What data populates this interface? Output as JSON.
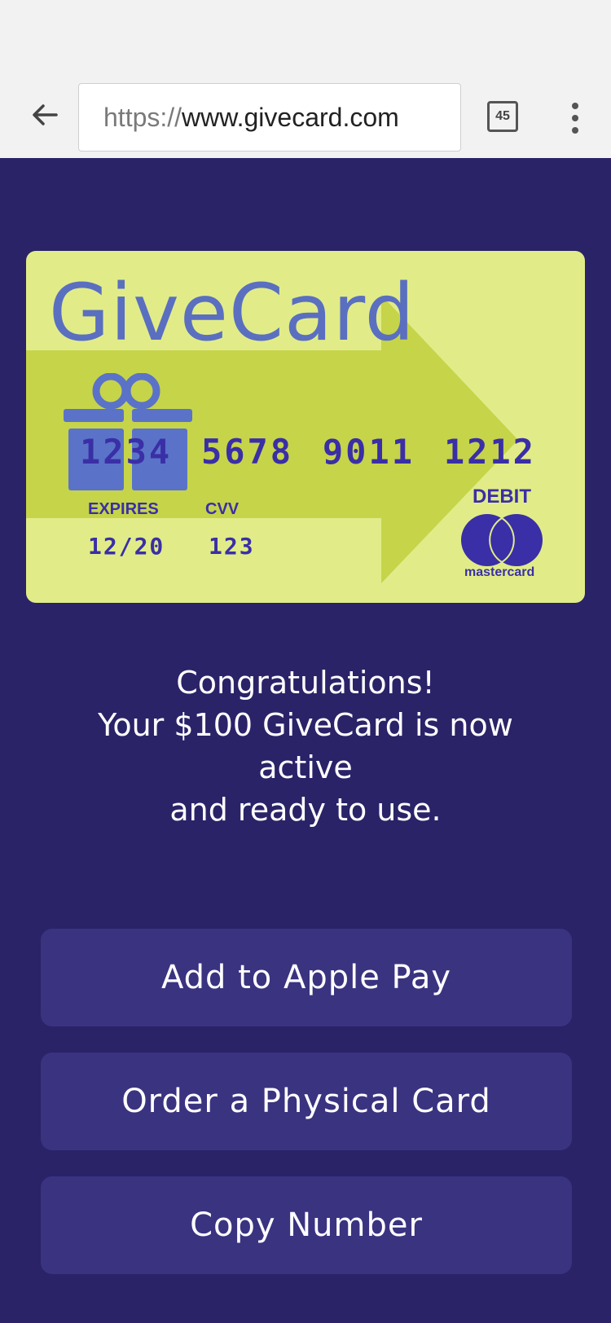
{
  "browser": {
    "url_scheme": "https://",
    "url_host": "www.givecard.com",
    "tab_count": "45",
    "icons": {
      "back": "back-arrow-icon",
      "tabs": "tabs-icon",
      "menu": "more-vert-icon"
    }
  },
  "card": {
    "brand": "GiveCard",
    "number_groups": [
      "1234",
      "5678",
      "9011",
      "1212"
    ],
    "expires_label": "EXPIRES",
    "expires_value": "12/20",
    "cvv_label": "CVV",
    "cvv_value": "123",
    "type_label": "DEBIT",
    "network": "mastercard",
    "colors": {
      "background": "#e1ec89",
      "arrow": "#c6d44a",
      "text": "#3a2fa6",
      "brand": "#5a6fc0"
    }
  },
  "message": {
    "line1": "Congratulations!",
    "line2": "Your $100 GiveCard is now active",
    "line3": "and ready to use."
  },
  "actions": {
    "apple_pay": "Add to Apple Pay",
    "physical_card": "Order a Physical Card",
    "copy_number": "Copy Number"
  },
  "colors": {
    "page_background": "#2a2368",
    "button_background": "#3a3380"
  }
}
